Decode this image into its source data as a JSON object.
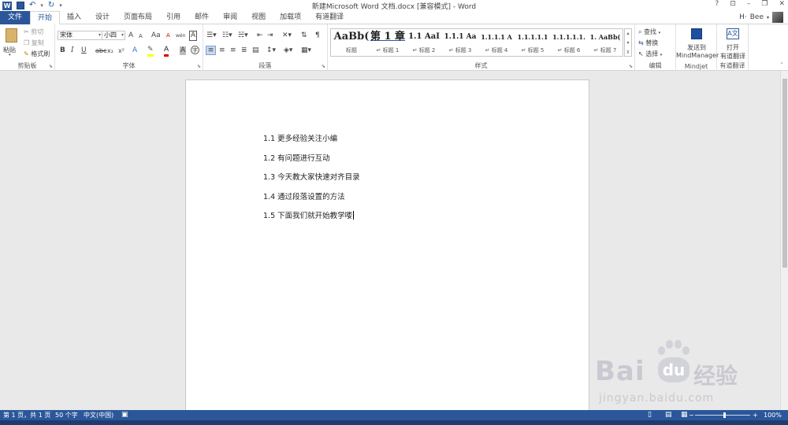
{
  "window": {
    "title": "新建Microsoft Word 文档.docx [兼容模式] - Word",
    "help": "?",
    "ribbon_display": "⊡",
    "minimize": "–",
    "restore": "❐",
    "close": "✕"
  },
  "qat": {
    "logo": "W",
    "save_icon": "💾",
    "undo": "↶",
    "redo": "↻",
    "more": "▾"
  },
  "tabs": {
    "file": "文件",
    "items": [
      "开始",
      "插入",
      "设计",
      "页面布局",
      "引用",
      "邮件",
      "审阅",
      "视图",
      "加载项",
      "有道翻译"
    ],
    "active_index": 0
  },
  "user": {
    "short": "H·",
    "name": "Bee",
    "dropdown": "▾"
  },
  "clipboard": {
    "label": "剪贴板",
    "paste": "粘贴",
    "cut": "剪切",
    "copy": "复制",
    "format_painter": "格式刷"
  },
  "font": {
    "label": "字体",
    "family": "宋体",
    "size": "小四",
    "bold": "B",
    "italic": "I",
    "underline": "U",
    "strike": "abc",
    "subscript": "x₂",
    "superscript": "x²",
    "clear": "A",
    "color_a": "A",
    "grow": "A",
    "shrink": "A",
    "case": "Aa",
    "phonetic": "wén",
    "border": "A"
  },
  "paragraph": {
    "label": "段落"
  },
  "styles": {
    "label": "样式",
    "items": [
      {
        "sample": "AaBb(",
        "name": "标题"
      },
      {
        "sample": "第 1 章",
        "name": "↵ 标题 1"
      },
      {
        "sample": "1.1  AaI",
        "name": "↵ 标题 2"
      },
      {
        "sample": "1.1.1 Aa",
        "name": "↵ 标题 3"
      },
      {
        "sample": "1.1.1.1 A",
        "name": "↵ 标题 4"
      },
      {
        "sample": "1.1.1.1.1",
        "name": "↵ 标题 5"
      },
      {
        "sample": "1.1.1.1.1.",
        "name": "↵ 标题 6"
      },
      {
        "sample": "1. AaBb(",
        "name": "↵ 标题 7"
      }
    ]
  },
  "editing": {
    "label": "编辑",
    "find": "查找",
    "replace": "替换",
    "select": "选择"
  },
  "mindjet": {
    "label": "Mindjet",
    "send_line1": "发送到",
    "send_line2": "MindManager"
  },
  "youdao": {
    "label": "有道翻译",
    "open_line1": "打开",
    "open_line2": "有道翻译"
  },
  "document": {
    "lines": [
      "1.1 更多经验关注小编",
      "1.2 有问题进行互动",
      "1.3 今天教大家快速对齐目录",
      "1.4 通过段落设置的方法",
      "1.5 下面我们就开始教学喽"
    ]
  },
  "status": {
    "page": "第 1 页，共 1 页",
    "words": "50 个字",
    "language": "中文(中国)",
    "zoom": "100%",
    "zoom_minus": "−",
    "zoom_plus": "+"
  },
  "watermark": {
    "brand": "Bai",
    "brand2": "经验",
    "url": "jingyan.baidu.com"
  },
  "colors": {
    "accent": "#2b579a",
    "highlight": "#ffff00",
    "font_red": "#e00000"
  }
}
